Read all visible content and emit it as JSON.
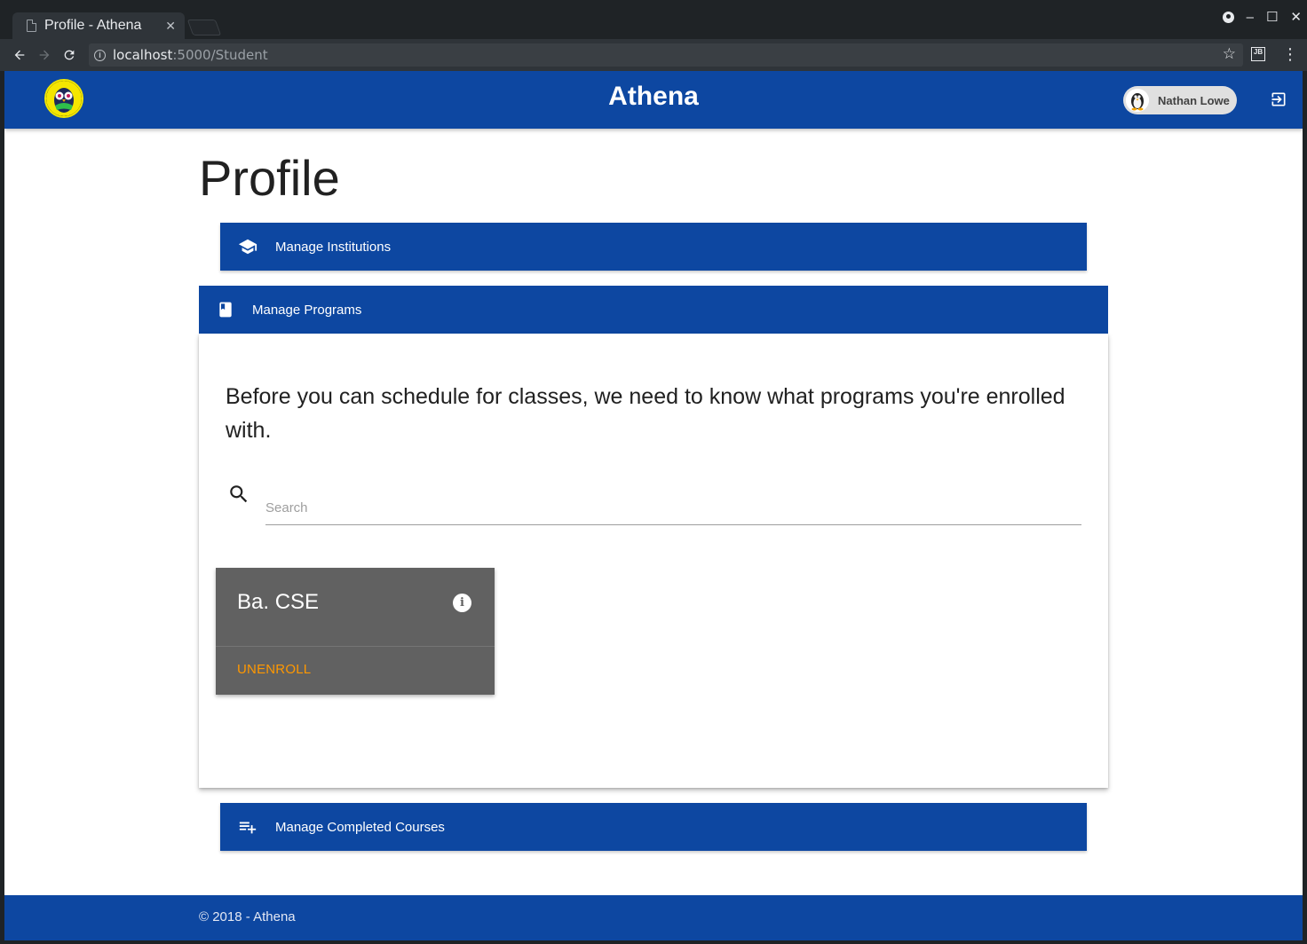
{
  "browser": {
    "tab_title": "Profile - Athena",
    "tab_close": "✕",
    "url_host": "localhost",
    "url_rest": ":5000/Student",
    "ext_label": "JB",
    "window_controls": {
      "minimize": "‒",
      "maximize": "☐",
      "close": "✕"
    }
  },
  "header": {
    "app_title": "Athena",
    "user_name": "Nathan Lowe"
  },
  "page": {
    "title": "Profile"
  },
  "panels": {
    "institutions": {
      "label": "Manage Institutions",
      "icon": "school-icon"
    },
    "programs": {
      "label": "Manage Programs",
      "icon": "book-icon",
      "intro": "Before you can schedule for classes, we need to know what programs you're enrolled with.",
      "search_placeholder": "Search",
      "cards": [
        {
          "title": "Ba. CSE",
          "action": "UNENROLL"
        }
      ]
    },
    "completed": {
      "label": "Manage Completed Courses",
      "icon": "playlist-add-icon"
    }
  },
  "footer": {
    "text": "© 2018 - Athena"
  },
  "colors": {
    "primary": "#0d47a1",
    "accent": "#ff9800",
    "card": "#616161"
  }
}
